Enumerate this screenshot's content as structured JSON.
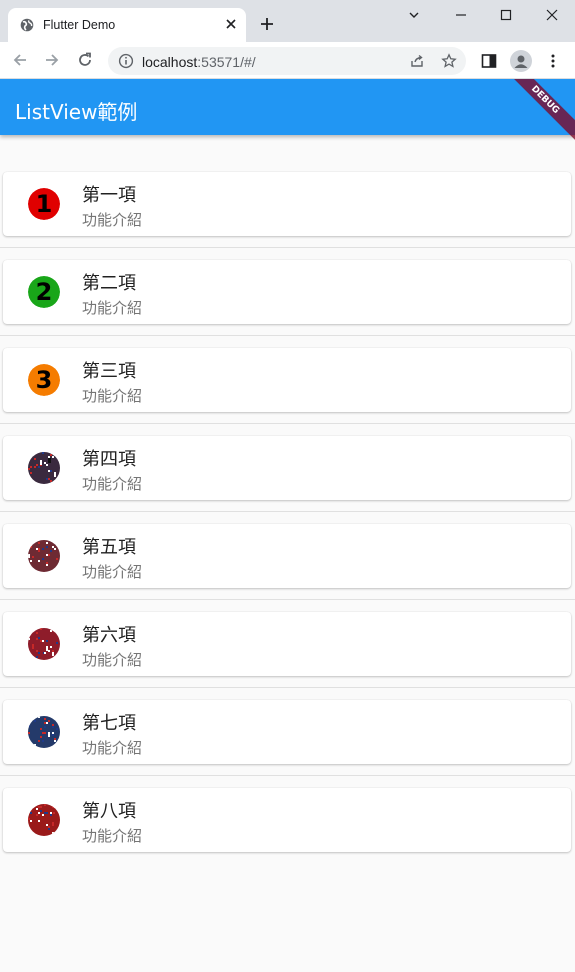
{
  "browser": {
    "tab_title": "Flutter Demo",
    "url_host": "localhost",
    "url_port": ":53571/#/"
  },
  "app": {
    "title": "ListView範例",
    "debug_banner": "DEBUG",
    "items": [
      {
        "title": "第一項",
        "subtitle": "功能介紹",
        "lead": "1",
        "lead_color": "#e00000"
      },
      {
        "title": "第二項",
        "subtitle": "功能介紹",
        "lead": "2",
        "lead_color": "#19a619"
      },
      {
        "title": "第三項",
        "subtitle": "功能介紹",
        "lead": "3",
        "lead_color": "#f57c00"
      },
      {
        "title": "第四項",
        "subtitle": "功能介紹",
        "lead": "image",
        "lead_color": "#3a2a3f"
      },
      {
        "title": "第五項",
        "subtitle": "功能介紹",
        "lead": "image",
        "lead_color": "#6e2a33"
      },
      {
        "title": "第六項",
        "subtitle": "功能介紹",
        "lead": "image",
        "lead_color": "#8e1c2a"
      },
      {
        "title": "第七項",
        "subtitle": "功能介紹",
        "lead": "image",
        "lead_color": "#243a6a"
      },
      {
        "title": "第八項",
        "subtitle": "功能介紹",
        "lead": "image",
        "lead_color": "#9a1a1a"
      }
    ]
  },
  "colors": {
    "appbar": "#2196f3",
    "page_bg": "#fafafa"
  }
}
